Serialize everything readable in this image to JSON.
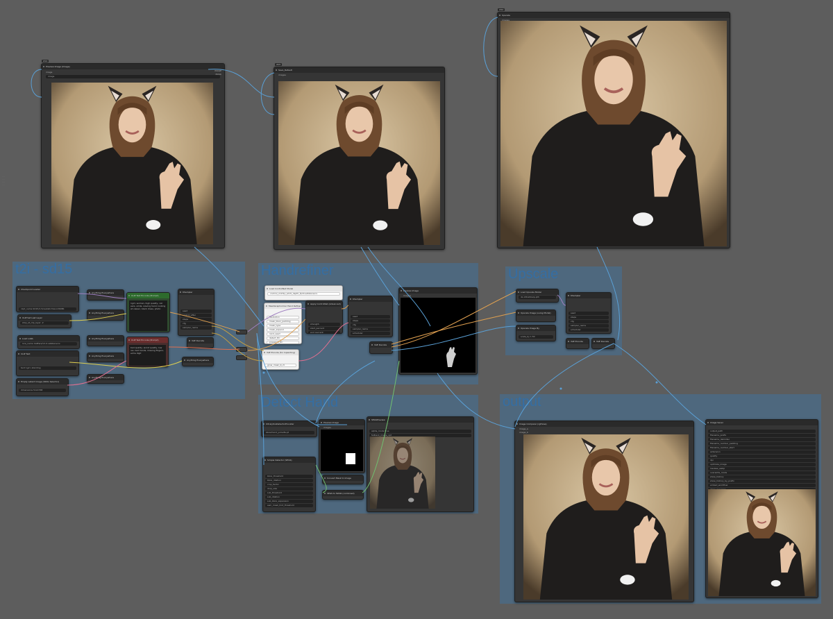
{
  "groups": [
    {
      "id": "t2i",
      "title": "t2i - sd15"
    },
    {
      "id": "handrefiner",
      "title": "Handrefiner"
    },
    {
      "id": "upscale",
      "title": "Upscale"
    },
    {
      "id": "detect",
      "title": "Detect Hand"
    },
    {
      "id": "output",
      "title": "output"
    }
  ],
  "nodes": {
    "preview1": {
      "badge": "#24",
      "title": "Preview Image (Image)",
      "input": "image",
      "out1": "IMAGE",
      "out2": "MASK",
      "widget": "image"
    },
    "preview2": {
      "badge": "#25",
      "title": "Save_Default",
      "input": "images"
    },
    "upscale_preview": {
      "badge": "#40",
      "title": "Upscale",
      "input": "images"
    },
    "ckpt": {
      "title": "Checkpoint Loader",
      "widget": "ckpt_name  SD15/1.5/realisticVisionV60B1"
    },
    "clip_set": {
      "title": "CLIP Set Last Layer",
      "widget": "stop_at_clip_layer  -2"
    },
    "lora": {
      "title": "Load LoRA",
      "widget": "lora_name  CatEars/V1.0.safetensors"
    },
    "clip_text": {
      "title": "CLIP Text",
      "widget": "text  1girl, standing"
    },
    "latent": {
      "title": "Empty Latent Image (SDXL Selector)",
      "widget": "dimensions  512x768"
    },
    "pos_prompt": {
      "title": "CLIP Text Encode (Prompt)",
      "text": "1girl, woman, high quality, cat ears, smile, waving hand, looking at viewer, black dress, photo"
    },
    "neg_prompt": {
      "title": "CLIP Text Encode (Prompt)",
      "text": "bad quality, worst quality, low res, bad hands, missing fingers, extra digit"
    },
    "ksampler1": {
      "title": "KSampler",
      "rows": [
        "seed",
        "control_after",
        "steps",
        "cfg",
        "sampler_name",
        "scheduler",
        "denoise"
      ]
    },
    "vae_decode1": {
      "title": "VAE Decode"
    },
    "anything1": {
      "title": "Anything Everywhere"
    },
    "anything2": {
      "title": "Anything Everywhere"
    },
    "anything3": {
      "title": "Anything Everywhere"
    },
    "anything4": {
      "title": "Anything Everywhere"
    },
    "controlnet_loader": {
      "title": "Load ControlNet Model",
      "widget": "control_v11f1p_sd15_depth_fp16.safetensors"
    },
    "meshgraphormer": {
      "title": "MeshGraphormer Hand Refiner",
      "rows": [
        "resolution",
        "mask_bbox_padding",
        "mask_type",
        "mask_expand",
        "rand_seed",
        "detect_thr",
        "presence_thr"
      ]
    },
    "apply_controlnet": {
      "title": "Apply ControlNet (Advanced)",
      "rows": [
        "strength",
        "start_percent",
        "end_percent"
      ]
    },
    "ksampler2": {
      "title": "KSampler",
      "rows": [
        "seed",
        "steps",
        "cfg",
        "sampler_name",
        "scheduler",
        "denoise"
      ]
    },
    "vae_decode2": {
      "title": "VAE Decode"
    },
    "vae_encode_inpaint": {
      "title": "VAE Encode (for Inpainting)",
      "widget": "grow_mask_by  6"
    },
    "preview_mask": {
      "title": "Preview Image",
      "input": "images"
    },
    "upscale_model": {
      "title": "Load Upscale Model",
      "widget": "4x-UltraSharp.pth"
    },
    "upscale_with_model": {
      "title": "Upscale Image (using Model)"
    },
    "upscale_by": {
      "title": "Upscale Image By",
      "widget": "scale_by  1.50"
    },
    "vae_encode_up": {
      "title": "VAE Encode"
    },
    "ksampler3": {
      "title": "KSampler",
      "rows": [
        "seed",
        "steps",
        "cfg",
        "sampler_name",
        "scheduler",
        "denoise"
      ]
    },
    "vae_decode3": {
      "title": "VAE Decode"
    },
    "ultralytics": {
      "title": "UltralyticsDetectorProvider",
      "widget": "bbox/hand_yolov8s.pt",
      "out1": "BBOX_DETECTOR",
      "out2": "SEGM_DETECTOR"
    },
    "simple_detector": {
      "title": "Simple Detector (SEGS)",
      "rows": [
        "bbox_threshold",
        "bbox_dilation",
        "crop_factor",
        "drop_size",
        "sub_threshold",
        "sub_dilation",
        "sub_bbox_expansion",
        "sam_mask_hint_threshold",
        "post_dilation"
      ]
    },
    "preview_detect": {
      "title": "Preview Image",
      "input": "images"
    },
    "convert_mask": {
      "title": "Convert Mask to Image"
    },
    "segs_to_mask": {
      "title": "SEGS to MASK (combined)"
    },
    "segs_preview": {
      "title": "SEGSPreview",
      "widget": "alpha_mode  true",
      "widget2": "fallback_image_opt"
    },
    "image_comparer": {
      "title": "Image Comparer (rgthree)",
      "in1": "image_a",
      "in2": "image_b"
    },
    "image_saver": {
      "title": "Image Saver",
      "rows": [
        "output_path",
        "filename_prefix",
        "filename_delimiter",
        "filename_number_padding",
        "filename_number_start",
        "extension",
        "quality",
        "dpi",
        "optimize_image",
        "lossless_webp",
        "overwrite_mode",
        "show_history",
        "show_history_by_prefix",
        "embed_workflow",
        "show_previews"
      ]
    }
  }
}
